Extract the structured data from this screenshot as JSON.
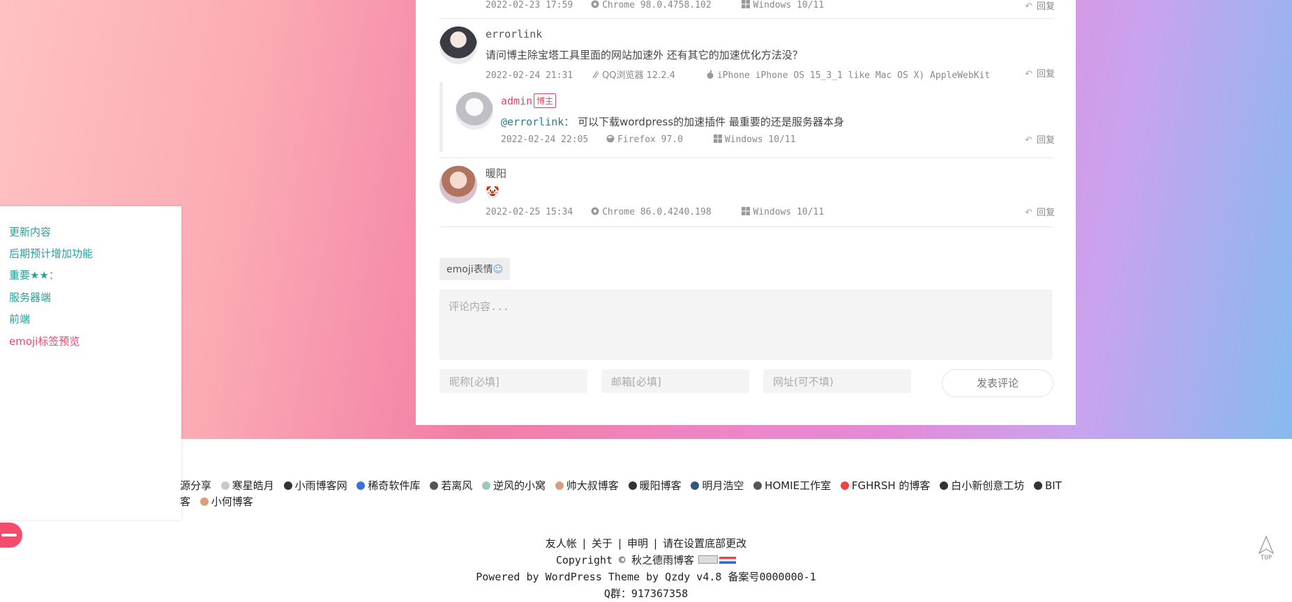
{
  "comments": [
    {
      "id": "prev",
      "time": "2022-02-23 17:59",
      "browser": "Chrome 98.0.4758.102",
      "os": "Windows 10/11",
      "reply": "回复"
    },
    {
      "id": "errorlink",
      "name": "errorlink",
      "text": "请问博主除宝塔工具里面的网站加速外  还有其它的加速优化方法没？",
      "time": "2022-02-24 21:31",
      "browser": "QQ浏览器 12.2.4",
      "os": "iPhone iPhone OS 15_3_1 like Mac OS X) AppleWebKit",
      "reply": "回复"
    },
    {
      "id": "admin",
      "name": "admin",
      "badge": "博主",
      "mention": "@errorlink：",
      "text": " 可以下载wordpress的加速插件  最重要的还是服务器本身",
      "time": "2022-02-24 22:05",
      "browser": "Firefox 97.0",
      "os": "Windows 10/11",
      "reply": "回复"
    },
    {
      "id": "nuanyang",
      "name": "暖阳",
      "emoji": "🤡",
      "time": "2022-02-25 15:34",
      "browser": "Chrome 86.0.4240.198",
      "os": "Windows 10/11",
      "reply": "回复"
    }
  ],
  "form": {
    "emoji_label": "emoji表情",
    "emoji_smile": "☺",
    "content_placeholder": "评论内容...",
    "nickname_placeholder": "昵称[必填]",
    "email_placeholder": "邮箱[必填]",
    "url_placeholder": "网址(可不填)",
    "submit_label": "发表评论"
  },
  "toc": [
    {
      "label": "更新内容",
      "active": false
    },
    {
      "label": "后期预计增加功能",
      "active": false
    },
    {
      "label": "重要★★：",
      "active": false
    },
    {
      "label": "服务器端",
      "active": false
    },
    {
      "label": "前端",
      "active": false
    },
    {
      "label": "emoji标签预览",
      "active": true
    }
  ],
  "friend_links_row1": [
    "源分享",
    "寒星皓月",
    "小雨博客网",
    "稀奇软件库",
    "若离风",
    "逆风的小窝",
    "帅大叔博客",
    "暖阳博客",
    "明月浩空",
    "HOMIE工作室",
    "FGHRSH 的博客",
    "白小新创意工坊",
    "BIT"
  ],
  "friend_links_row2": [
    "客",
    "小何博客"
  ],
  "footer": {
    "nav": [
      "友人帐",
      "关于",
      "申明",
      "请在设置底部更改"
    ],
    "copyright": "Copyright © 秋之德雨博客",
    "powered": "Powered by WordPress Theme by Qzdy v4.8 备案号0000000-1",
    "qq": "Q群：917367358"
  },
  "top_label": "TOP",
  "colors": {
    "accent": "#2b9f9b",
    "active": "#e8466c",
    "admin": "#e04a62"
  }
}
